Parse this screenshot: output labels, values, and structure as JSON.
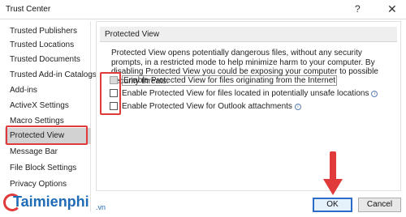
{
  "window": {
    "title": "Trust Center",
    "help_icon": "?",
    "close_icon": "✕"
  },
  "sidebar": {
    "items": [
      {
        "label": "Trusted Publishers"
      },
      {
        "label": "Trusted Locations"
      },
      {
        "label": "Trusted Documents"
      },
      {
        "label": "Trusted Add-in Catalogs"
      },
      {
        "label": "Add-ins"
      },
      {
        "label": "ActiveX Settings"
      },
      {
        "label": "Macro Settings"
      },
      {
        "label": "Protected View",
        "selected": true
      },
      {
        "label": "Message Bar"
      },
      {
        "label": "File Block Settings"
      },
      {
        "label": "Privacy Options"
      }
    ]
  },
  "panel": {
    "header": "Protected View",
    "description": "Protected View opens potentially dangerous files, without any security prompts, in a restricted mode to help minimize harm to your computer. By disabling Protected View you could be exposing your computer to possible security threats.",
    "options": [
      {
        "label": "Enable Protected View for files originating from the Internet",
        "checked": false,
        "disabled": true
      },
      {
        "label": "Enable Protected View for files located in potentially unsafe locations",
        "checked": false,
        "info": "i"
      },
      {
        "label": "Enable Protected View for Outlook attachments",
        "checked": false,
        "info": "i"
      }
    ]
  },
  "footer": {
    "ok_label": "OK",
    "cancel_label": "Cancel"
  },
  "watermark": {
    "text": "Taimienphi",
    "suffix": ".vn"
  },
  "colors": {
    "highlight": "#e03a3a",
    "selected_bg": "#d2d2d2",
    "ok_border": "#2a6cc7"
  }
}
